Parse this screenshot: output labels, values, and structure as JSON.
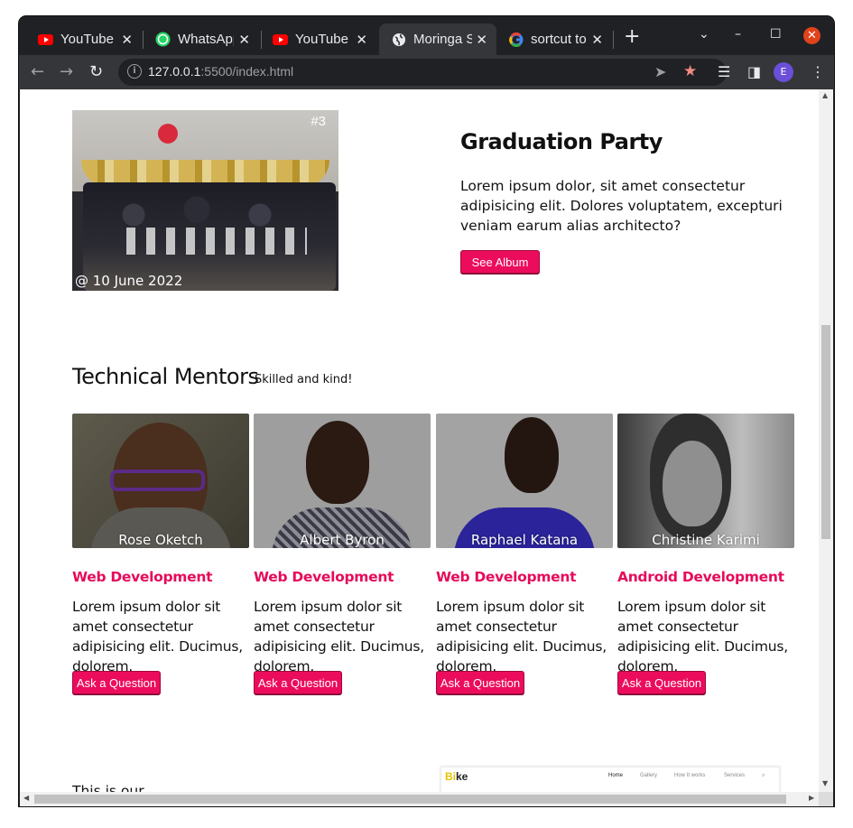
{
  "browser": {
    "tabs": [
      {
        "title": "YouTube",
        "icon": "youtube-icon",
        "active": false
      },
      {
        "title": "WhatsApp",
        "icon": "whatsapp-icon",
        "active": false
      },
      {
        "title": "YouTube",
        "icon": "youtube-icon",
        "active": false
      },
      {
        "title": "Moringa S",
        "icon": "globe-icon",
        "active": true
      },
      {
        "title": "sortcut to",
        "icon": "google-icon",
        "active": false
      }
    ],
    "url_host": "127.0.0.1",
    "url_rest": ":5500/index.html",
    "profile_initial": "E"
  },
  "album": {
    "number": "#3",
    "date": "@ 10 June 2022",
    "title": "Graduation Party",
    "text": "Lorem ipsum dolor, sit amet consectetur adipisicing elit. Dolores voluptatem, excepturi veniam earum alias architecto?",
    "button": "See Album"
  },
  "mentors": {
    "title": "Technical Mentors",
    "subtitle": "Skilled and kind!",
    "items": [
      {
        "name": "Rose Oketch",
        "role": "Web Development",
        "desc": "Lorem ipsum dolor sit amet consectetur adipisicing elit. Ducimus, dolorem.",
        "button": "Ask a Question"
      },
      {
        "name": "Albert Byron",
        "role": "Web Development",
        "desc": "Lorem ipsum dolor sit amet consectetur adipisicing elit. Ducimus, dolorem.",
        "button": "Ask a Question"
      },
      {
        "name": "Raphael Katana",
        "role": "Web Development",
        "desc": "Lorem ipsum dolor sit amet consectetur adipisicing elit. Ducimus, dolorem.",
        "button": "Ask a Question"
      },
      {
        "name": "Christine Karimi",
        "role": "Android Development",
        "desc": "Lorem ipsum dolor sit amet consectetur adipisicing elit. Ducimus, dolorem.",
        "button": "Ask a Question"
      }
    ]
  },
  "next_section": {
    "text": "This is our",
    "preview_logo_b": "Bi",
    "preview_logo_rest": "ke",
    "preview_nav": [
      "Home",
      "Gallery",
      "How It works",
      "Services"
    ]
  },
  "colors": {
    "accent": "#ec0c5c",
    "role_text": "#e60b5a",
    "browser_frame": "#202124"
  }
}
